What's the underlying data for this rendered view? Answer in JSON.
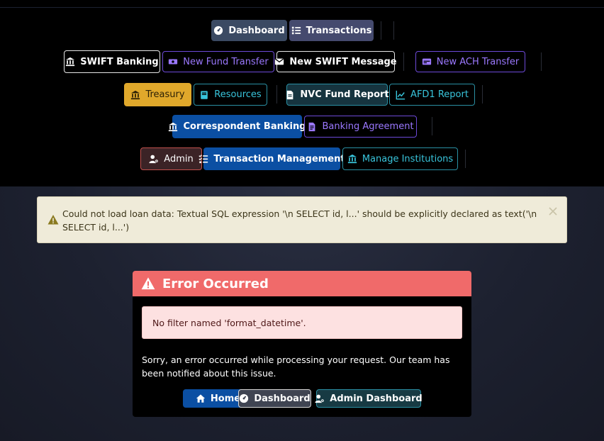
{
  "nav": {
    "row1": {
      "dashboard": "Dashboard",
      "transactions": "Transactions"
    },
    "row2": {
      "swift_banking": "SWIFT Banking",
      "new_fund_transfer": "New Fund Transfer",
      "new_swift_message": "New SWIFT Message",
      "new_ach_transfer": "New ACH Transfer"
    },
    "row3": {
      "treasury": "Treasury",
      "resources": "Resources",
      "nvc_fund_report": "NVC Fund Report",
      "afd1_report": "AFD1 Report"
    },
    "row4": {
      "correspondent_banking": "Correspondent Banking",
      "banking_agreement": "Banking Agreement"
    },
    "row5": {
      "admin": "Admin",
      "transaction_management": "Transaction Management",
      "manage_institutions": "Manage Institutions"
    }
  },
  "alert": {
    "message": "Could not load loan data: Textual SQL expression '\\n SELECT id, l...' should be explicitly declared as text('\\n SELECT id, l...')"
  },
  "error_card": {
    "title": "Error Occurred",
    "detail": "No filter named 'format_datetime'.",
    "body": "Sorry, an error occurred while processing your request. Our team has been notified about this issue.",
    "buttons": {
      "home": "Home",
      "dashboard": "Dashboard",
      "admin_dashboard": "Admin Dashboard"
    }
  },
  "colors": {
    "alert_bg": "#efebd9",
    "error_header": "#f06a6a",
    "error_detail_bg": "#fde1e1",
    "primary_blue": "#0b4fa3",
    "treasury_yellow": "#e0a82b",
    "teal": "#39c5dc",
    "purple": "#9b78ff"
  }
}
